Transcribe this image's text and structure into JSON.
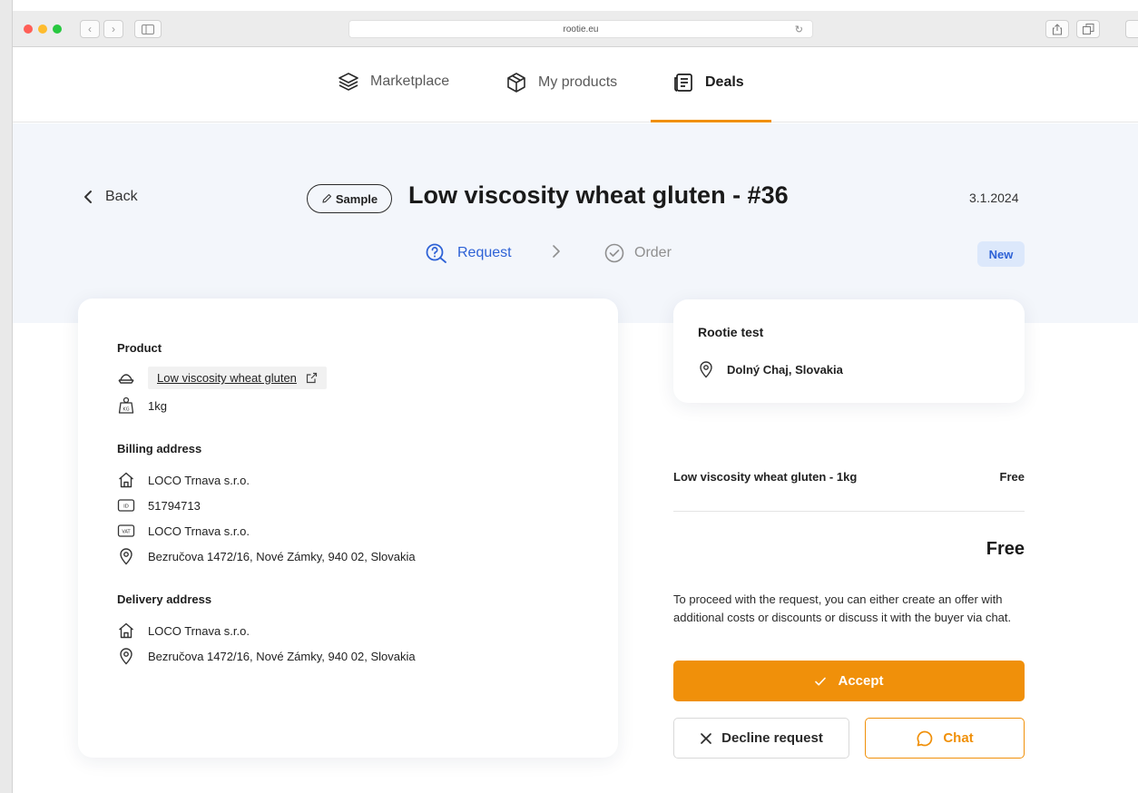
{
  "browser": {
    "url": "rootie.eu"
  },
  "nav": {
    "items": [
      {
        "label": "Marketplace",
        "icon": "layers-icon"
      },
      {
        "label": "My products",
        "icon": "box-icon"
      },
      {
        "label": "Deals",
        "icon": "document-list-icon",
        "active": true
      }
    ]
  },
  "header": {
    "back_label": "Back",
    "badge_label": "Sample",
    "title": "Low viscosity wheat gluten - #36",
    "date": "3.1.2024",
    "steps": [
      {
        "label": "Request",
        "state": "current"
      },
      {
        "label": "Order",
        "state": "pending"
      }
    ],
    "status": "New"
  },
  "product": {
    "label": "Product",
    "name": "Low viscosity wheat gluten",
    "quantity": "1kg"
  },
  "billing": {
    "label": "Billing address",
    "company": "LOCO Trnava s.r.o.",
    "company_id": "51794713",
    "vat_name": "LOCO Trnava s.r.o.",
    "address": "Bezručova 1472/16, Nové Zámky, 940 02, Slovakia"
  },
  "delivery": {
    "label": "Delivery address",
    "company": "LOCO Trnava s.r.o.",
    "address": "Bezručova 1472/16, Nové Zámky, 940 02, Slovakia"
  },
  "seller": {
    "name": "Rootie test",
    "location": "Dolný Chaj, Slovakia"
  },
  "summary": {
    "item_label": "Low viscosity wheat gluten - 1kg",
    "item_price": "Free",
    "total": "Free",
    "info": "To proceed with the request, you can either create an offer with additional costs or discounts or discuss it with the buyer via chat."
  },
  "actions": {
    "accept": "Accept",
    "decline": "Decline request",
    "chat": "Chat"
  },
  "colors": {
    "accent": "#f0900a",
    "link_blue": "#2e62d6",
    "band": "#f3f6fb"
  }
}
